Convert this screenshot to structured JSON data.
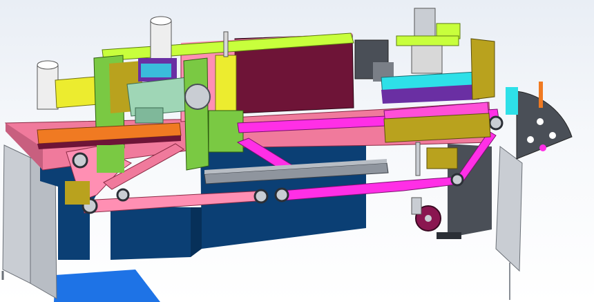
{
  "viewport": {
    "kind": "cad-3d-viewport",
    "background_top": "#e9eef5",
    "background_bottom": "#ffffff"
  },
  "colors": {
    "frame_pink": "#f07a9c",
    "plate_pink": "#ff8fb3",
    "belt_magenta": "#ff2fe6",
    "cabinet_navy": "#0b3f74",
    "cabinet_navy_dark": "#073059",
    "panel_grey": "#c9cdd3",
    "base_green": "#7ac943",
    "lime": "#c8ff3c",
    "olive": "#b9a21e",
    "motor_yellow": "#ecec2f",
    "motor_white": "#eeeeee",
    "gearbox_seafoam": "#9fd6b6",
    "dark_maroon": "#6e1437",
    "cyan": "#2ee0e8",
    "violet": "#6a2fa3",
    "orange": "#f07a22",
    "dark_grey": "#4a4f57",
    "wheel_magenta": "#8a1650",
    "floor_blue": "#1e73e6",
    "wire_dark": "#2b2f36"
  },
  "parts": [
    "servo-motor-left",
    "gear-motor-left",
    "servo-motor-center",
    "gear-motor-center",
    "servo-motor-top-right",
    "linear-actuator-right",
    "main-conveyor-belt",
    "return-belt",
    "conveyor-rail",
    "hand-wheel",
    "rotary-index-plate"
  ]
}
